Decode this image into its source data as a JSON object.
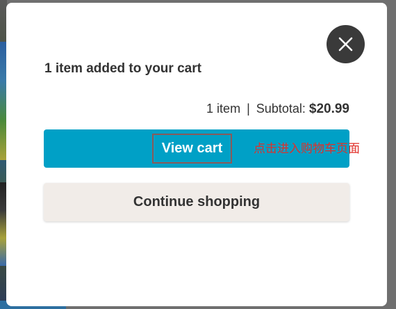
{
  "modal": {
    "title": "1 item added to your cart",
    "summary": {
      "count_text": "1 item",
      "separator": "|",
      "subtotal_label": "Subtotal:",
      "subtotal_amount": "$20.99"
    },
    "view_cart_label": "View cart",
    "annotation": "点击进入购物车页面",
    "continue_label": "Continue shopping",
    "close_icon": "close-icon"
  },
  "colors": {
    "primary_button": "#00a0c6",
    "secondary_button": "#f1ece8",
    "close_button": "#3a3a3a",
    "annotation": "#e0302a"
  }
}
